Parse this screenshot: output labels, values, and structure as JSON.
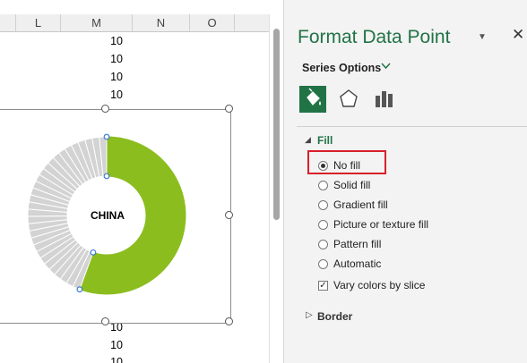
{
  "sheet": {
    "columns": [
      "L",
      "M",
      "N",
      "O"
    ],
    "values_above_chart": [
      "10",
      "10",
      "10",
      "10"
    ],
    "values_below_chart": [
      "10",
      "10",
      "10"
    ]
  },
  "chart": {
    "center_label": "CHINA",
    "highlight_color": "#8cbd1e",
    "other_slice_color": "#d3d3d3"
  },
  "pane": {
    "title": "Format Data Point",
    "series_options_label": "Series Options",
    "tabs": [
      {
        "icon": "paint-bucket-icon",
        "active": true
      },
      {
        "icon": "pentagon-effects-icon",
        "active": false
      },
      {
        "icon": "bar-chart-icon",
        "active": false
      }
    ],
    "fill_section": "Fill",
    "fill_options": [
      {
        "label": "No fill",
        "checked": true
      },
      {
        "label": "Solid fill",
        "checked": false
      },
      {
        "label": "Gradient fill",
        "checked": false
      },
      {
        "label": "Picture or texture fill",
        "checked": false
      },
      {
        "label": "Pattern fill",
        "checked": false
      },
      {
        "label": "Automatic",
        "checked": false
      }
    ],
    "vary_colors_label": "Vary colors by slice",
    "vary_colors_checked": true,
    "border_section": "Border",
    "accent_color": "#217346"
  }
}
